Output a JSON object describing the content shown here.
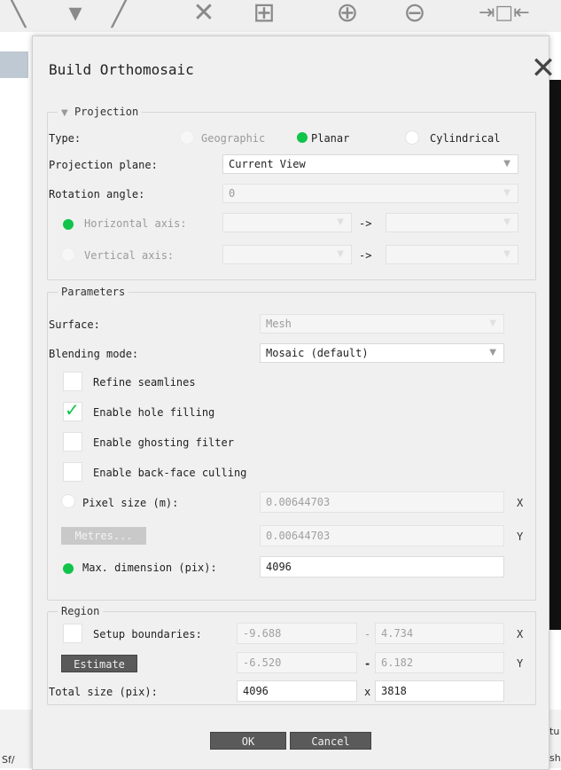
{
  "toolbar": {
    "icons": [
      "scale-icon",
      "pan-icon",
      "close-tool-icon",
      "move-icon",
      "zoom-in-icon",
      "zoom-out-icon",
      "expand-icon"
    ]
  },
  "background": {
    "bottom_left_text": "Sf/",
    "bottom_right_text_1": "tu",
    "bottom_right_text_2": "sh"
  },
  "dialog": {
    "title": "Build Orthomosaic",
    "projection": {
      "group_title": "Projection",
      "type_label": "Type:",
      "types": [
        "Geographic",
        "Planar",
        "Cylindrical"
      ],
      "selected_type": "Planar",
      "plane_label": "Projection plane:",
      "plane_value": "Current View",
      "rotation_label": "Rotation angle:",
      "rotation_value": "0",
      "horizontal_label": "Horizontal axis:",
      "vertical_label": "Vertical axis:",
      "arrow": "->"
    },
    "parameters": {
      "group_title": "Parameters",
      "surface_label": "Surface:",
      "surface_value": "Mesh",
      "blending_label": "Blending mode:",
      "blending_value": "Mosaic (default)",
      "refine_label": "Refine seamlines",
      "refine_checked": false,
      "hole_label": "Enable hole filling",
      "hole_checked": true,
      "ghost_label": "Enable ghosting filter",
      "ghost_checked": false,
      "backface_label": "Enable back-face culling",
      "backface_checked": false,
      "pixel_size_label": "Pixel size (m):",
      "pixel_x": "0.00644703",
      "pixel_y": "0.00644703",
      "x_axis": "X",
      "y_axis": "Y",
      "metres_label": "Metres...",
      "max_dim_label": "Max. dimension (pix):",
      "max_dim_value": "4096"
    },
    "region": {
      "group_title": "Region",
      "setup_label": "Setup boundaries:",
      "x_min": "-9.688",
      "x_max": "4.734",
      "y_min": "-6.520",
      "y_max": "6.182",
      "dash": "-",
      "estimate_label": "Estimate",
      "total_label": "Total size (pix):",
      "total_w": "4096",
      "total_h": "3818",
      "times": "x",
      "x_axis": "X",
      "y_axis": "Y"
    },
    "ok_label": "OK",
    "cancel_label": "Cancel"
  },
  "colors": {
    "accent": "#10c44a",
    "dialog_bg": "#f0f0f0"
  }
}
